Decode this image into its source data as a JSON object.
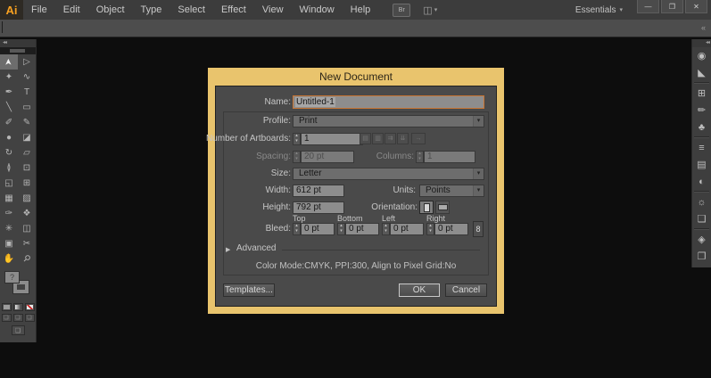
{
  "menu_bar": {
    "logo": "Ai",
    "items": [
      "File",
      "Edit",
      "Object",
      "Type",
      "Select",
      "Effect",
      "View",
      "Window",
      "Help"
    ],
    "bridge_label": "Br",
    "arrange_glyph": "◫",
    "workspace": "Essentials",
    "caret": "▾",
    "controls": {
      "minimize": "—",
      "restore": "❐",
      "close": "✕"
    }
  },
  "control_bar": {
    "collapse_glyph": "«"
  },
  "icons": {
    "stepper_up": "▴",
    "stepper_down": "▾",
    "dropdown_caret": "▾",
    "panel_collapse": "◂◂",
    "advanced_arrow": "▶",
    "artboard_grid": [
      "▤",
      "▥",
      "⇉",
      "⇊"
    ],
    "artboard_arrow": "→",
    "link_chain": "8",
    "draw_mode": "❏",
    "screen_mode": "❏"
  },
  "toolbar": {
    "fill_placeholder": "?",
    "tools": [
      {
        "name": "selection",
        "glyph": "➤"
      },
      {
        "name": "direct-selection",
        "glyph": "▷"
      },
      {
        "name": "magic-wand",
        "glyph": "✦"
      },
      {
        "name": "lasso",
        "glyph": "∿"
      },
      {
        "name": "pen",
        "glyph": "✒"
      },
      {
        "name": "type",
        "glyph": "T"
      },
      {
        "name": "line-segment",
        "glyph": "╲"
      },
      {
        "name": "rectangle",
        "glyph": "▭"
      },
      {
        "name": "paintbrush",
        "glyph": "✐"
      },
      {
        "name": "pencil",
        "glyph": "✎"
      },
      {
        "name": "blob-brush",
        "glyph": "●"
      },
      {
        "name": "eraser",
        "glyph": "◪"
      },
      {
        "name": "rotate",
        "glyph": "↻"
      },
      {
        "name": "scale",
        "glyph": "▱"
      },
      {
        "name": "width",
        "glyph": "≬"
      },
      {
        "name": "free-transform",
        "glyph": "⊡"
      },
      {
        "name": "shape-builder",
        "glyph": "◱"
      },
      {
        "name": "perspective-grid",
        "glyph": "⊞"
      },
      {
        "name": "mesh",
        "glyph": "▦"
      },
      {
        "name": "gradient",
        "glyph": "▨"
      },
      {
        "name": "eyedropper",
        "glyph": "✑"
      },
      {
        "name": "blend",
        "glyph": "❖"
      },
      {
        "name": "symbol-sprayer",
        "glyph": "✳"
      },
      {
        "name": "column-graph",
        "glyph": "◫"
      },
      {
        "name": "artboard",
        "glyph": "▣"
      },
      {
        "name": "slice",
        "glyph": "✂"
      },
      {
        "name": "hand",
        "glyph": "✋"
      },
      {
        "name": "zoom",
        "glyph": "⚲"
      }
    ]
  },
  "right_panel": {
    "icons": [
      {
        "name": "color",
        "glyph": "◉"
      },
      {
        "name": "color-guide",
        "glyph": "◣"
      },
      {
        "name": "swatches",
        "glyph": "⊞"
      },
      {
        "name": "brushes",
        "glyph": "✏"
      },
      {
        "name": "symbols",
        "glyph": "♣"
      },
      {
        "name": "stroke",
        "glyph": "≡"
      },
      {
        "name": "gradient",
        "glyph": "▤"
      },
      {
        "name": "transparency",
        "glyph": "◐"
      },
      {
        "name": "appearance",
        "glyph": "☼"
      },
      {
        "name": "graphic-styles",
        "glyph": "❑"
      },
      {
        "name": "layers",
        "glyph": "◈"
      },
      {
        "name": "artboards",
        "glyph": "❐"
      }
    ]
  },
  "dialog": {
    "title": "New Document",
    "name": {
      "label": "Name:",
      "value": "Untitled-1"
    },
    "profile": {
      "label": "Profile:",
      "value": "Print"
    },
    "artboards": {
      "label": "Number of Artboards:",
      "value": "1"
    },
    "spacing": {
      "label": "Spacing:",
      "value": "20 pt"
    },
    "columns": {
      "label": "Columns:",
      "value": "1"
    },
    "size": {
      "label": "Size:",
      "value": "Letter"
    },
    "width": {
      "label": "Width:",
      "value": "612 pt"
    },
    "units": {
      "label": "Units:",
      "value": "Points"
    },
    "height": {
      "label": "Height:",
      "value": "792 pt"
    },
    "orientation": {
      "label": "Orientation:"
    },
    "bleed": {
      "label": "Bleed:",
      "columns": [
        "Top",
        "Bottom",
        "Left",
        "Right"
      ],
      "values": [
        "0 pt",
        "0 pt",
        "0 pt",
        "0 pt"
      ]
    },
    "advanced": {
      "label": "Advanced"
    },
    "summary": "Color Mode:CMYK, PPI:300, Align to Pixel Grid:No",
    "buttons": {
      "templates": "Templates...",
      "ok": "OK",
      "cancel": "Cancel"
    }
  },
  "colors": {
    "dialog_frame": "#e9c46d",
    "focus_border": "#c87533",
    "logo_orange": "#f7a021",
    "dialog_bg": "#4a4a4a",
    "field_bg": "#8d8d8d",
    "canvas_bg": "#0d0d0d"
  }
}
